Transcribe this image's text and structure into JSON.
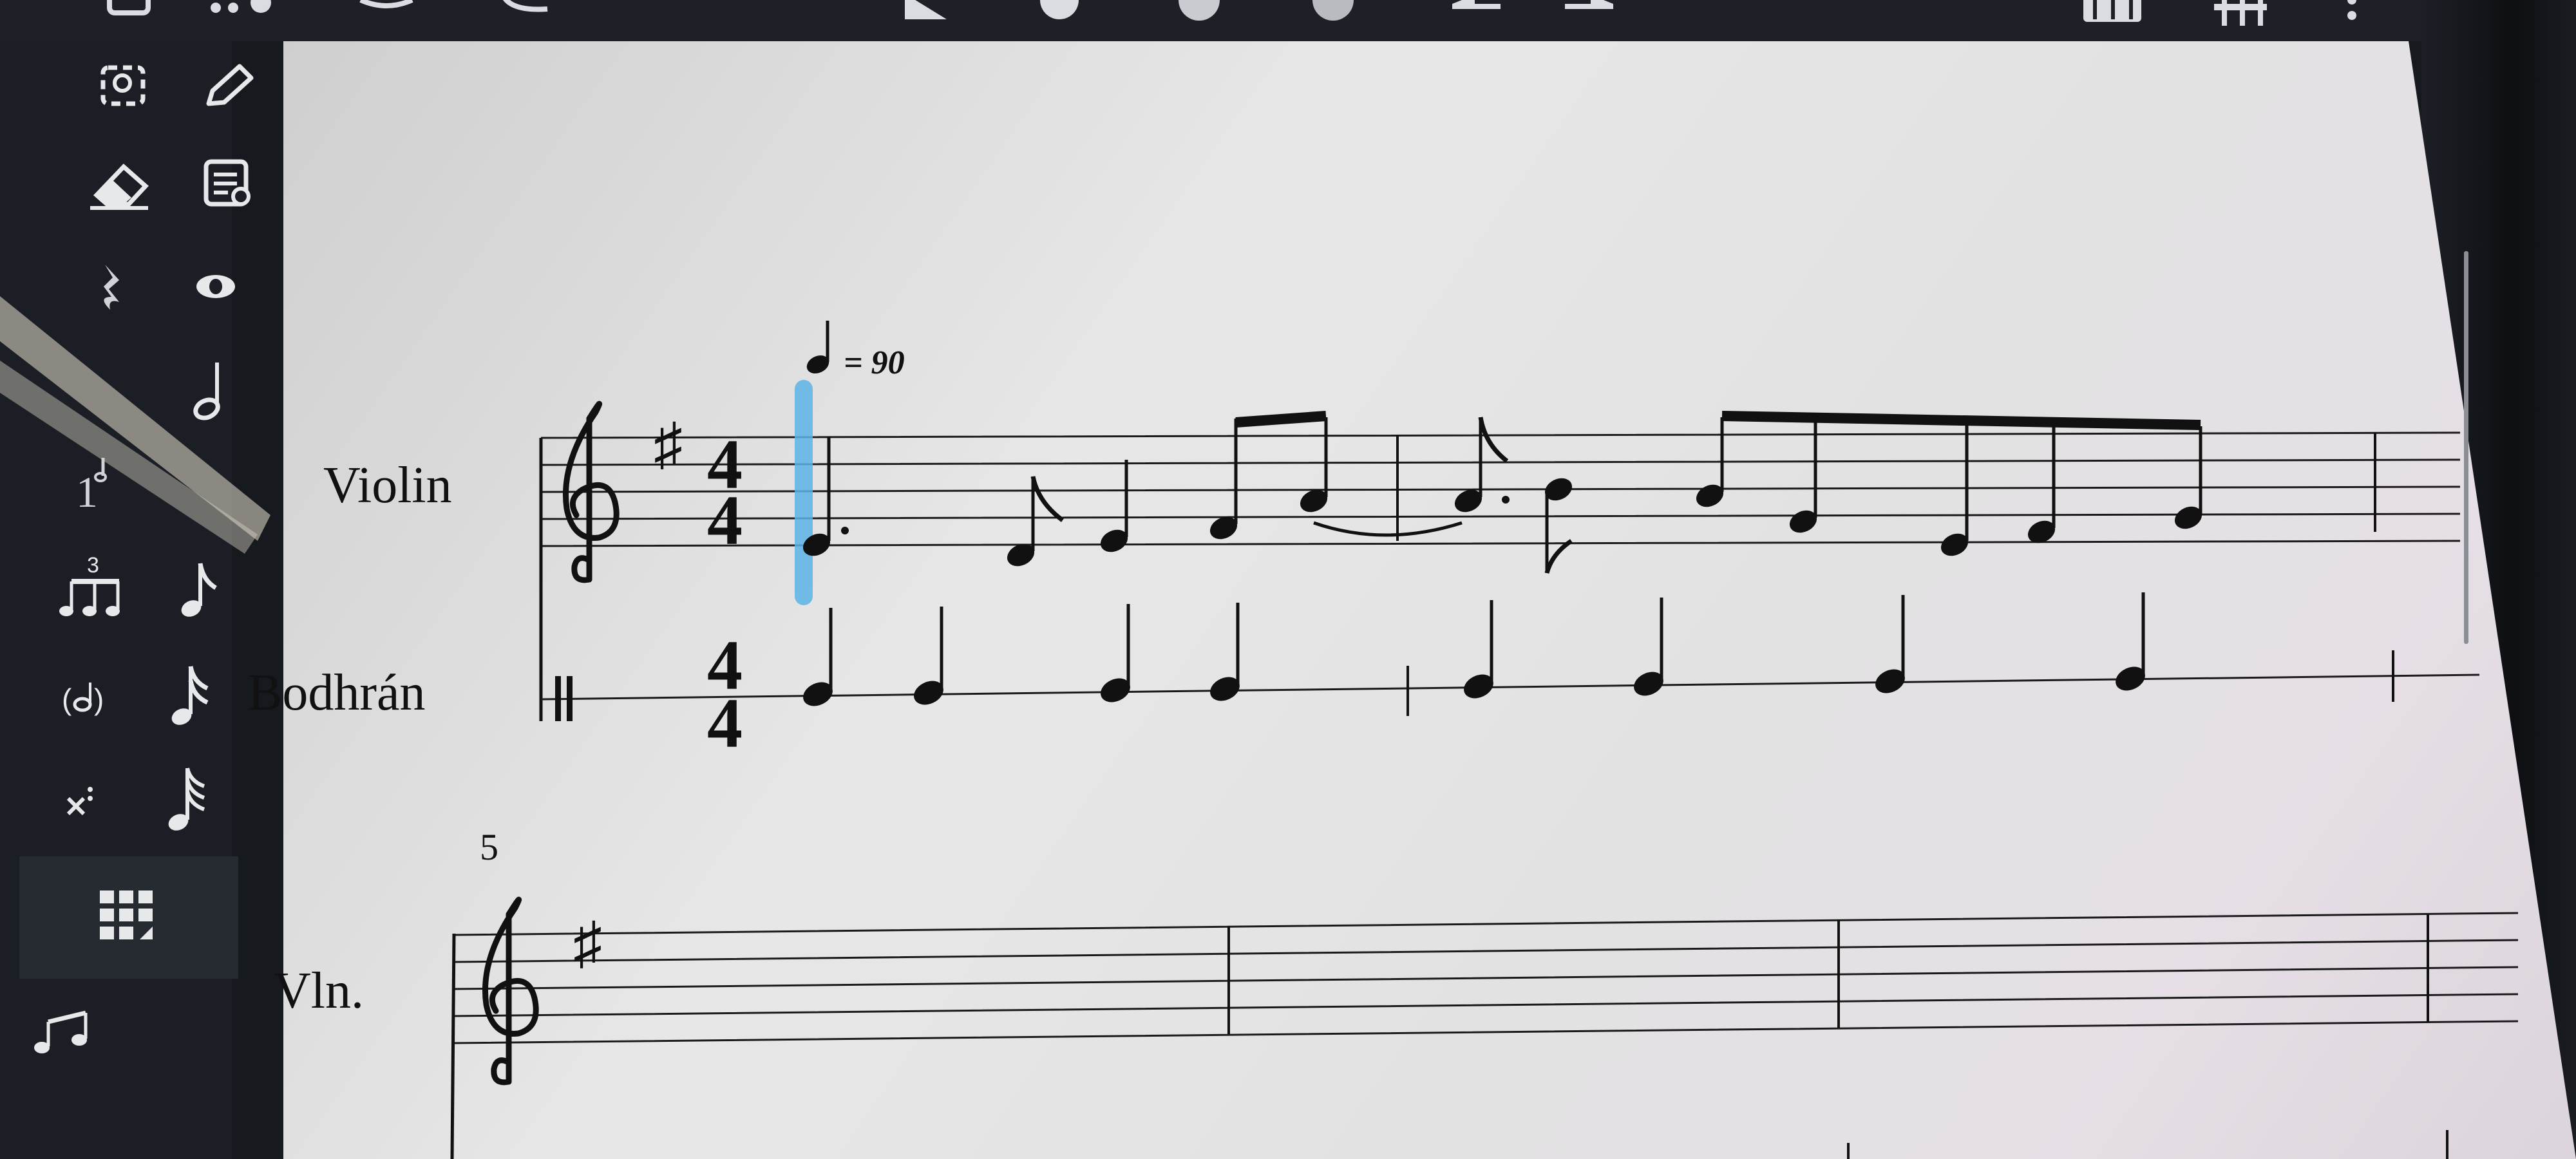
{
  "score": {
    "tempo": {
      "value": "= 90"
    },
    "system1": {
      "violin": {
        "name": "Violin",
        "key_signature": "G major (1 sharp)",
        "time_signature": {
          "top": "4",
          "bottom": "4"
        }
      },
      "bodhran": {
        "name": "Bodhrán",
        "clef": "percussion",
        "time_signature": {
          "top": "4",
          "bottom": "4"
        }
      }
    },
    "system2": {
      "measure_number": "5",
      "violin": {
        "name": "Vln.",
        "key_signature": "G major (1 sharp)"
      }
    }
  },
  "toolbar": {
    "icons": [
      "select-icon",
      "pencil-icon",
      "eraser-icon",
      "properties-icon",
      "rest-icon",
      "view-icon",
      "half-note-icon",
      "voice-icon",
      "tuplet-icon",
      "eighth-note-icon",
      "grace-note-icon",
      "sixteenth-note-icon",
      "cross-staff-icon",
      "thirtysecond-note-icon",
      "grid-keypad-icon",
      "notes-icon"
    ],
    "top_icons": [
      "mixer-icon",
      "piano-keyboard-icon",
      "more-icon",
      "play-icon",
      "loop-icon",
      "metronome-icon",
      "undo-icon",
      "redo-icon"
    ],
    "colors": {
      "selection": "#5ab4e6",
      "sidebar": "#1b1f25",
      "page": "#e3e3e3",
      "ink": "#111111"
    }
  }
}
